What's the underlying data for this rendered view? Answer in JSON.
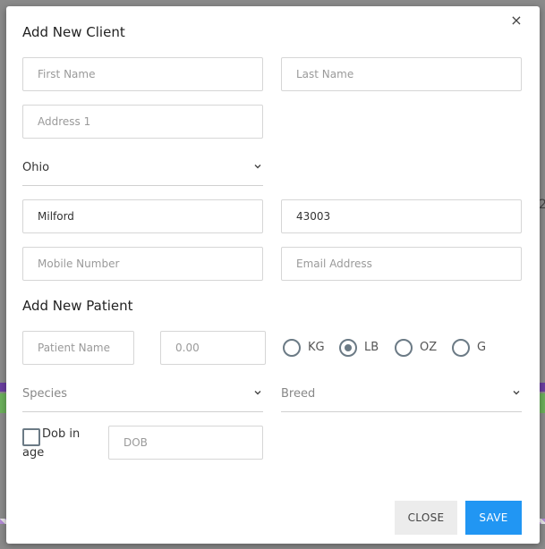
{
  "modal": {
    "title": "Add New Client",
    "close_icon": "×",
    "client": {
      "first_name": {
        "placeholder": "First Name",
        "value": ""
      },
      "last_name": {
        "placeholder": "Last Name",
        "value": ""
      },
      "address1": {
        "placeholder": "Address 1",
        "value": ""
      },
      "state": {
        "value": "Ohio"
      },
      "city": {
        "value": "Milford"
      },
      "zip": {
        "value": "43003"
      },
      "mobile": {
        "placeholder": "Mobile Number",
        "value": ""
      },
      "email": {
        "placeholder": "Email Address",
        "value": ""
      }
    },
    "patient_section_title": "Add New Patient",
    "patient": {
      "name": {
        "placeholder": "Patient Name",
        "value": ""
      },
      "weight": {
        "placeholder": "0.00",
        "value": ""
      },
      "weight_units": [
        {
          "label": "KG",
          "selected": false
        },
        {
          "label": "LB",
          "selected": true
        },
        {
          "label": "OZ",
          "selected": false
        },
        {
          "label": "G",
          "selected": false
        }
      ],
      "species": {
        "placeholder": "Species"
      },
      "breed": {
        "placeholder": "Breed"
      },
      "dob_in_age_label_1": "Dob in",
      "dob_in_age_label_2": "age",
      "dob_in_age_checked": false,
      "dob": {
        "placeholder": "DOB",
        "value": ""
      }
    },
    "buttons": {
      "close": "CLOSE",
      "save": "SAVE"
    }
  },
  "colors": {
    "primary": "#2196f3",
    "radio": "#6b7a85",
    "background_overlay": "#8a8a8a"
  },
  "background_fragment_text": "2"
}
